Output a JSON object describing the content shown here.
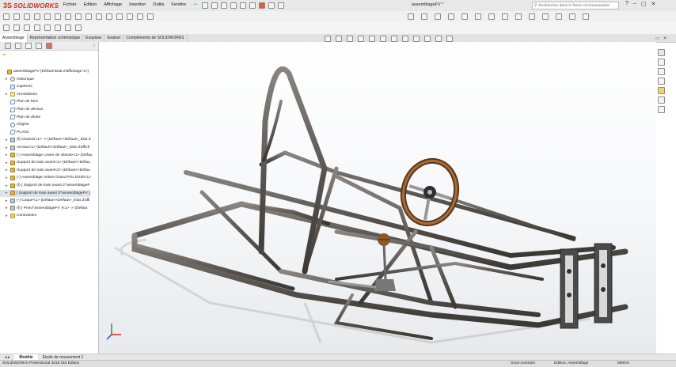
{
  "app": {
    "logo_mark": "3S",
    "logo_text": "SOLIDWORKS",
    "document_title": "assemblageFV *"
  },
  "menu": [
    "Fichier",
    "Edition",
    "Affichage",
    "Insertion",
    "Outils",
    "Fenêtre"
  ],
  "search": {
    "placeholder": "Rechercher dans le forum communautaire"
  },
  "window_buttons": [
    "?",
    "–",
    "▢",
    "✕"
  ],
  "command_tabs": [
    {
      "label": "Assemblage",
      "active": true
    },
    {
      "label": "Représentation schématique",
      "active": false
    },
    {
      "label": "Esquisse",
      "active": false
    },
    {
      "label": "Evaluer",
      "active": false
    },
    {
      "label": "Compléments de SOLIDWORKS",
      "active": false
    }
  ],
  "feature_tree": {
    "filter_icon": "filter-icon",
    "items": [
      {
        "label": "assemblageFV  (Défaut<Etat d'affichage-1>)",
        "icon": "assembly",
        "indent": 0,
        "expander": ""
      },
      {
        "label": "Historique",
        "icon": "history",
        "indent": 1,
        "expander": "▸"
      },
      {
        "label": "Capteurs",
        "icon": "sensor",
        "indent": 1,
        "expander": ""
      },
      {
        "label": "Annotations",
        "icon": "annotation",
        "indent": 1,
        "expander": "▸"
      },
      {
        "label": "Plan de face",
        "icon": "plane",
        "indent": 1,
        "expander": ""
      },
      {
        "label": "Plan de dessus",
        "icon": "plane",
        "indent": 1,
        "expander": ""
      },
      {
        "label": "Plan de droite",
        "icon": "plane",
        "indent": 1,
        "expander": ""
      },
      {
        "label": "Origine",
        "icon": "origin",
        "indent": 1,
        "expander": ""
      },
      {
        "label": "PLAN1",
        "icon": "plane",
        "indent": 1,
        "expander": ""
      },
      {
        "label": "(f) Chassis<1> -> (Défaut<<Défaut>_Etat d",
        "icon": "part",
        "indent": 1,
        "expander": "▸"
      },
      {
        "label": "Arceau<1> (Défaut<<Défaut>_Etat d'affich",
        "icon": "part",
        "indent": 1,
        "expander": "▸"
      },
      {
        "label": "(-) Assemblage Levier de vitesse<1> (Défau",
        "icon": "assembly",
        "indent": 1,
        "expander": "▸"
      },
      {
        "label": "Support de train avant<1> (Défaut<<Défau",
        "icon": "assembly",
        "indent": 1,
        "expander": "▸"
      },
      {
        "label": "Support de train avant<2> (Défaut<<Défau",
        "icon": "assembly",
        "indent": 1,
        "expander": "▸"
      },
      {
        "label": "(-) Assemblage Volant Grand Prix D230<1>",
        "icon": "assembly",
        "indent": 1,
        "expander": "▸"
      },
      {
        "label": "(f) [ Support de train avant 2^assemblageF",
        "icon": "assembly",
        "indent": 1,
        "expander": "▸"
      },
      {
        "label": "[ Support de train avant 2^assemblageFV ]",
        "icon": "assembly",
        "indent": 1,
        "expander": "▸"
      },
      {
        "label": "(-) Coque<1> (Défaut<<Défaut>_Etat d'affi",
        "icon": "part",
        "indent": 1,
        "expander": "▸"
      },
      {
        "label": "(f) [ Pneu^assemblageFV ]<1> -> (Défaut",
        "icon": "part",
        "indent": 1,
        "expander": "▸"
      },
      {
        "label": "Contraintes",
        "icon": "folder",
        "indent": 1,
        "expander": "▸"
      }
    ]
  },
  "bottom_tabs": [
    {
      "label": "Modèle",
      "active": true
    },
    {
      "label": "Etude de mouvement 1",
      "active": false
    }
  ],
  "status": {
    "product": "SOLIDWORKS Professional 2018 x64 Edition",
    "state": "Sous-contraint",
    "mode": "Edition: Assemblage",
    "units": "MMGS"
  },
  "viewport": {
    "model": "go-kart-chassis-assembly",
    "triad": "xyz-triad-icon"
  }
}
